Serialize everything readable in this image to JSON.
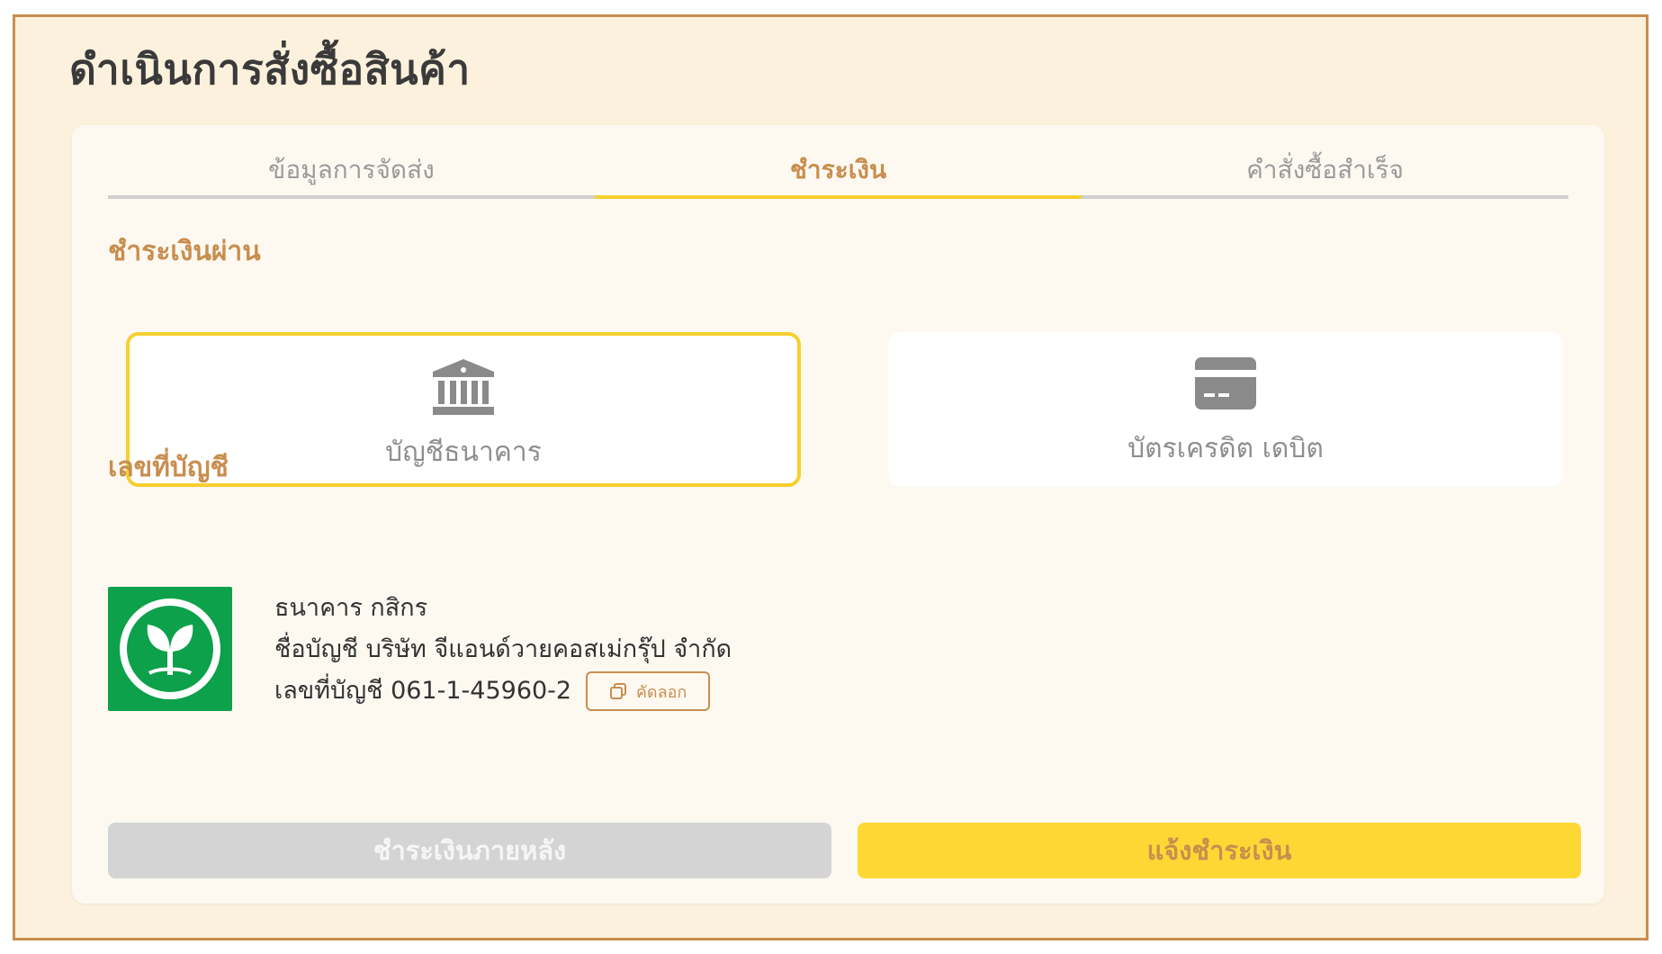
{
  "page": {
    "title": "ดำเนินการสั่งซื้อสินค้า"
  },
  "tabs": [
    {
      "label": "ข้อมูลการจัดส่ง",
      "active": false
    },
    {
      "label": "ชำระเงิน",
      "active": true
    },
    {
      "label": "คำสั่งซื้อสำเร็จ",
      "active": false
    }
  ],
  "payment": {
    "section_label": "ชำระเงินผ่าน",
    "methods": [
      {
        "label": "บัญชีธนาคาร",
        "icon": "bank-icon",
        "selected": true
      },
      {
        "label": "บัตรเครดิต เดบิต",
        "icon": "credit-card-icon",
        "selected": false
      }
    ]
  },
  "account": {
    "section_label": "เลขที่บัญชี",
    "bank_name": "ธนาคาร กสิกร",
    "account_name": "ชื่อบัญชี บริษัท จีแอนด์วายคอสเม่กรุ๊ป จำกัด",
    "account_number": "เลขที่บัญชี 061-1-45960-2",
    "copy_label": "คัดลอก",
    "logo_icon": "kasikorn-bank-logo"
  },
  "actions": {
    "pay_later": "ชำระเงินภายหลัง",
    "notify_payment": "แจ้งชำระเงิน"
  },
  "colors": {
    "accent": "#c88e4f",
    "yellow": "#fdd835",
    "page_bg": "#fcf1dc",
    "bank_green": "#0ca14a"
  }
}
